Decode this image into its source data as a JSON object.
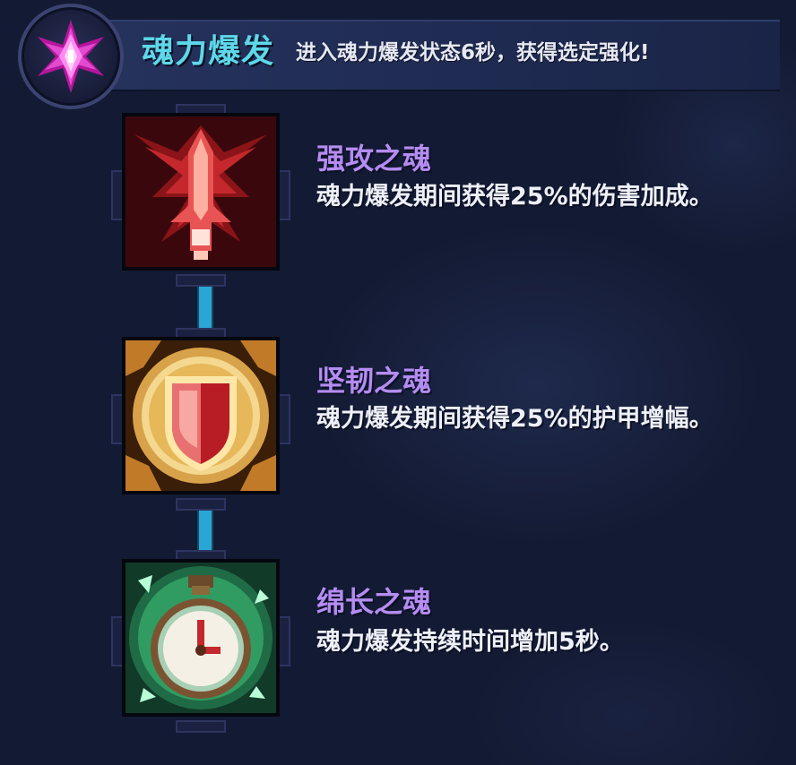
{
  "header": {
    "title": "魂力爆发",
    "description": "进入魂力爆发状态6秒，获得选定强化!",
    "emblem_icon": "purple-crystal-star-icon"
  },
  "skills": [
    {
      "name": "强攻之魂",
      "description": "魂力爆发期间获得25%的伤害加成。",
      "icon": "red-sword-soul-icon",
      "accent": "#c4282c"
    },
    {
      "name": "坚韧之魂",
      "description": "魂力爆发期间获得25%的护甲增幅。",
      "icon": "gold-shield-soul-icon",
      "accent": "#e0a03c"
    },
    {
      "name": "绵长之魂",
      "description": "魂力爆发持续时间增加5秒。",
      "icon": "green-stopwatch-soul-icon",
      "accent": "#3fc47a"
    }
  ],
  "colors": {
    "title": "#5ed8e8",
    "skill_name": "#b58cf2",
    "connector": "#2aa6d4",
    "background": "#131a33"
  }
}
